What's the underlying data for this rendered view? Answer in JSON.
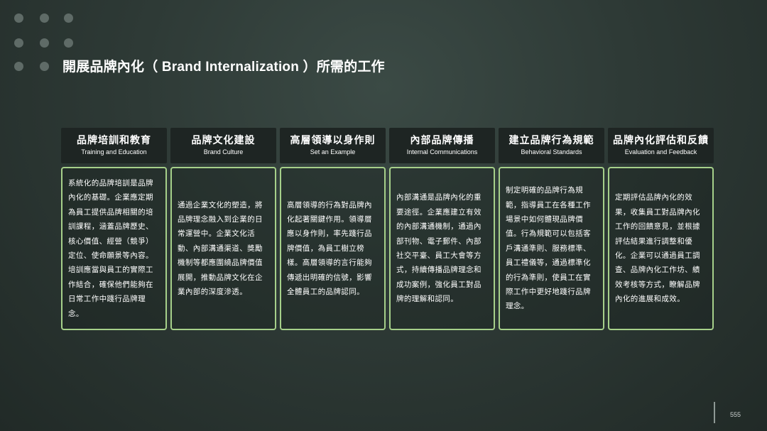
{
  "slide": {
    "title": "開展品牌內化（ Brand Internalization ）所需的工作",
    "page_number": "555",
    "accent_color": "#a6d08a",
    "header_bg": "#1e2523"
  },
  "columns": [
    {
      "title_zh": "品牌培訓和教育",
      "title_en": "Training and Education",
      "body": "系統化的品牌培訓是品牌內化的基礎。企業應定期為員工提供品牌相關的培訓課程，涵蓋品牌歷史、核心價值、經營（競爭）定位、使命願景等內容。培訓應當與員工的實際工作結合，確保他們能夠在日常工作中踐行品牌理念。"
    },
    {
      "title_zh": "品牌文化建設",
      "title_en": "Brand Culture",
      "body": "通過企業文化的塑造，將品牌理念融入到企業的日常運營中。企業文化活動、內部溝通渠道、獎勵機制等都應圍繞品牌價值展開，推動品牌文化在企業內部的深度滲透。"
    },
    {
      "title_zh": "高層領導以身作則",
      "title_en": "Set an Example",
      "body": "高層領導的行為對品牌內化起著關鍵作用。領導層應以身作則，率先踐行品牌價值，為員工樹立榜樣。高層領導的言行能夠傳遞出明確的信號，影響全體員工的品牌認同。"
    },
    {
      "title_zh": "內部品牌傳播",
      "title_en": "Internal Communications",
      "body": "內部溝通是品牌內化的重要途徑。企業應建立有效的內部溝通機制，通過內部刊物、電子郵件、內部社交平臺、員工大會等方式，持續傳播品牌理念和成功案例，強化員工對品牌的理解和認同。"
    },
    {
      "title_zh": "建立品牌行為規範",
      "title_en": "Behavioral Standards",
      "body": "制定明確的品牌行為規範，指導員工在各種工作場景中如何體現品牌價值。行為規範可以包括客戶溝通準則、服務標準、員工禮儀等，通過標準化的行為準則，使員工在實際工作中更好地踐行品牌理念。"
    },
    {
      "title_zh": "品牌內化評估和反饋",
      "title_en": "Evaluation and Feedback",
      "body": "定期評估品牌內化的效果，收集員工對品牌內化工作的回饋意見，並根據評估結果進行調整和優化。企業可以通過員工調查、品牌內化工作坊、績效考核等方式，瞭解品牌內化的進展和成效。"
    }
  ]
}
